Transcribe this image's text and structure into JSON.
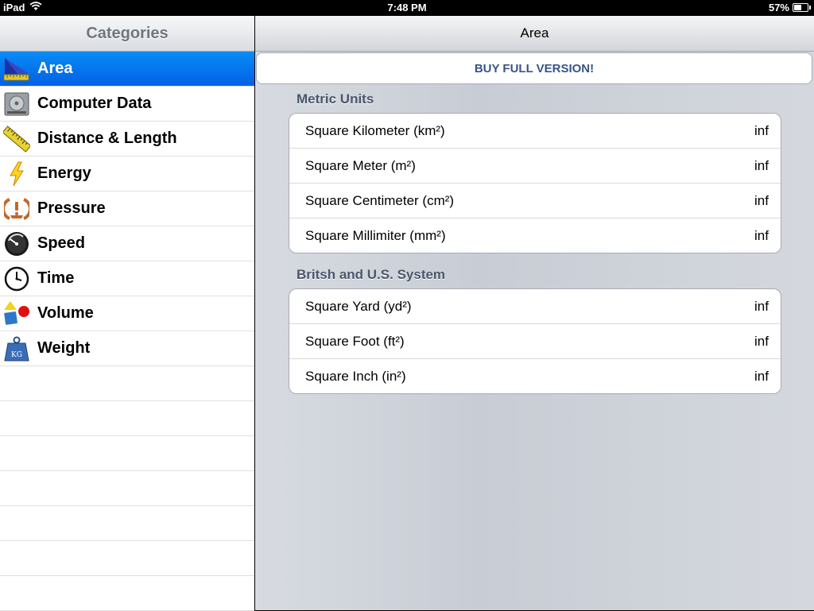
{
  "status_bar": {
    "device": "iPad",
    "time": "7:48 PM",
    "battery": "57%",
    "battery_level": 0.57
  },
  "master": {
    "title": "Categories",
    "selected": "Area",
    "items": [
      {
        "label": "Area",
        "icon": "area-icon"
      },
      {
        "label": "Computer Data",
        "icon": "hard-drive-icon"
      },
      {
        "label": "Distance & Length",
        "icon": "ruler-icon"
      },
      {
        "label": "Energy",
        "icon": "lightning-icon"
      },
      {
        "label": "Pressure",
        "icon": "pressure-warning-icon"
      },
      {
        "label": "Speed",
        "icon": "speedometer-icon"
      },
      {
        "label": "Time",
        "icon": "clock-icon"
      },
      {
        "label": "Volume",
        "icon": "shapes-icon"
      },
      {
        "label": "Weight",
        "icon": "kg-weight-icon"
      }
    ]
  },
  "detail": {
    "title": "Area",
    "buy_button": "BUY FULL VERSION!",
    "sections": [
      {
        "title": "Metric Units",
        "rows": [
          {
            "label": "Square Kilometer (km²)",
            "value": "inf"
          },
          {
            "label": "Square Meter (m²)",
            "value": "inf"
          },
          {
            "label": "Square Centimeter (cm²)",
            "value": "inf"
          },
          {
            "label": "Square Millimiter (mm²)",
            "value": "inf"
          }
        ]
      },
      {
        "title": "Britsh and U.S. System",
        "rows": [
          {
            "label": "Square Yard (yd²)",
            "value": "inf"
          },
          {
            "label": "Square Foot (ft²)",
            "value": "inf"
          },
          {
            "label": "Square Inch (in²)",
            "value": "inf"
          }
        ]
      }
    ]
  }
}
